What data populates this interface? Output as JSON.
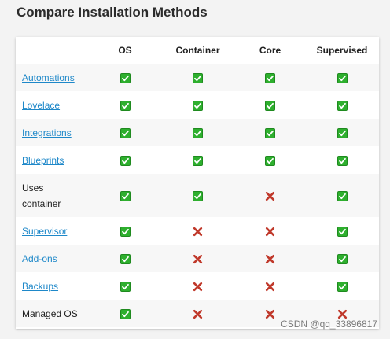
{
  "title": "Compare Installation Methods",
  "columns": [
    "",
    "OS",
    "Container",
    "Core",
    "Supervised"
  ],
  "rows": [
    {
      "label": "Automations",
      "link": true,
      "values": [
        "check",
        "check",
        "check",
        "check"
      ]
    },
    {
      "label": "Lovelace",
      "link": true,
      "values": [
        "check",
        "check",
        "check",
        "check"
      ]
    },
    {
      "label": "Integrations",
      "link": true,
      "values": [
        "check",
        "check",
        "check",
        "check"
      ]
    },
    {
      "label": "Blueprints",
      "link": true,
      "values": [
        "check",
        "check",
        "check",
        "check"
      ]
    },
    {
      "label": "Uses container",
      "link": false,
      "values": [
        "check",
        "check",
        "cross",
        "check"
      ]
    },
    {
      "label": "Supervisor",
      "link": true,
      "values": [
        "check",
        "cross",
        "cross",
        "check"
      ]
    },
    {
      "label": "Add-ons",
      "link": true,
      "values": [
        "check",
        "cross",
        "cross",
        "check"
      ]
    },
    {
      "label": "Backups",
      "link": true,
      "values": [
        "check",
        "cross",
        "cross",
        "check"
      ]
    },
    {
      "label": "Managed OS",
      "link": false,
      "values": [
        "check",
        "cross",
        "cross",
        "cross"
      ]
    }
  ],
  "icons": {
    "check": "check-mark-icon",
    "cross": "cross-mark-icon"
  },
  "colors": {
    "check_green": "#2eaf2e",
    "cross_red": "#c0392b",
    "link": "#1e88c9"
  },
  "watermark": "CSDN @qq_33896817"
}
